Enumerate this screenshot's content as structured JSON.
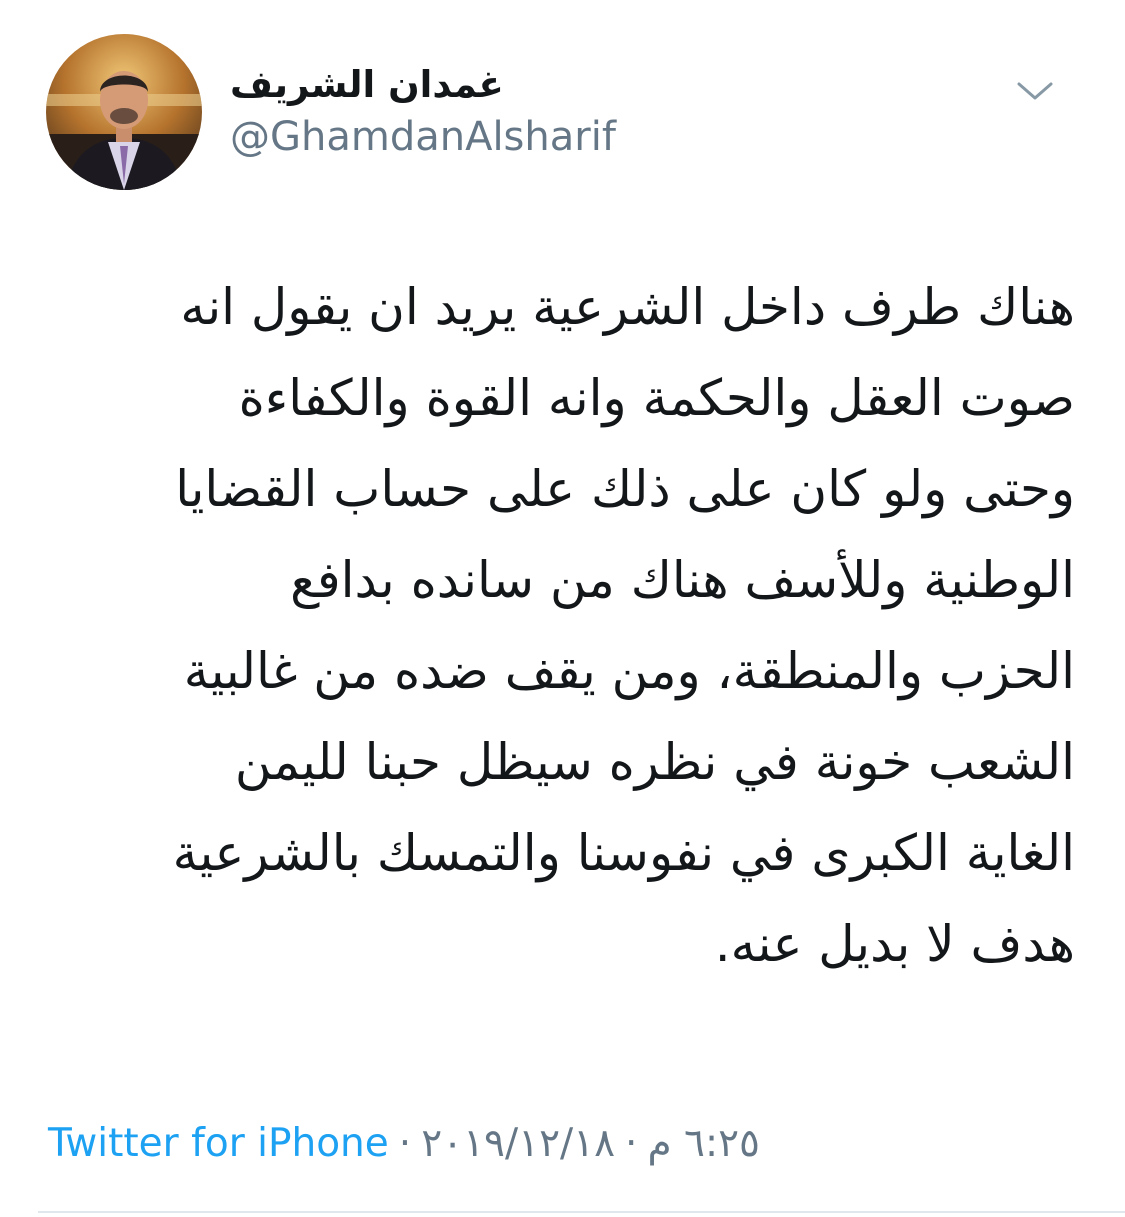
{
  "author": {
    "display_name": "غمدان الشريف",
    "handle": "@GhamdanAlsharif"
  },
  "tweet": {
    "lines": [
      "هناك طرف داخل الشرعية يريد ان يقول انه",
      "صوت العقل والحكمة وانه القوة والكفاءة",
      "وحتى ولو كان على ذلك على حساب القضايا",
      "الوطنية وللأسف هناك من سانده بدافع",
      "الحزب والمنطقة، ومن يقف ضده من غالبية",
      "الشعب خونة في نظره سيظل حبنا لليمن",
      "الغاية الكبرى في نفوسنا والتمسك بالشرعية",
      "هدف لا بديل عنه."
    ]
  },
  "meta": {
    "source": "Twitter for iPhone",
    "separator": "·",
    "date": "٢٠١٩/١٢/١٨",
    "time": "٦:٢٥ م"
  },
  "icons": {
    "chevron": "chevron-down-icon",
    "avatar": "avatar"
  },
  "colors": {
    "link": "#1da1f2",
    "secondary": "#657786",
    "text": "#14171a",
    "divider": "#e1e8ed"
  }
}
